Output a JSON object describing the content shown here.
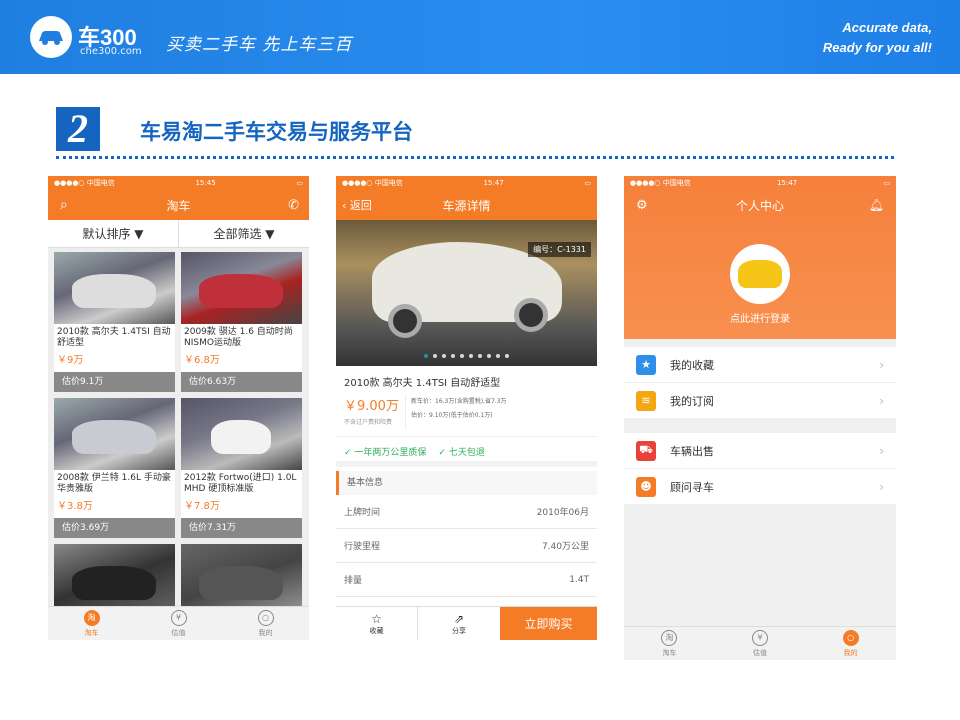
{
  "header": {
    "brand": "车300",
    "domain": "che300.com",
    "slogan": "买卖二手车 先上车三百",
    "tagline_line1": "Accurate data,",
    "tagline_line2": "Ready for you all!"
  },
  "section": {
    "number": "2",
    "title": "车易淘二手车交易与服务平台"
  },
  "status": {
    "carrier": "●●●●○ 中国电信",
    "time1": "15:45",
    "time2": "15:47",
    "time3": "15:47"
  },
  "phone1": {
    "nav_title": "淘车",
    "sort_default": "默认排序",
    "sort_filter": "全部筛选",
    "cars": [
      {
        "name": "2010款 高尔夫 1.4TSI 自动舒适型",
        "price": "￥9万",
        "estimate": "估价9.1万"
      },
      {
        "name": "2009款 骐达 1.6 自动时尚NISMO运动版",
        "price": "￥6.8万",
        "estimate": "估价6.63万"
      },
      {
        "name": "2008款 伊兰特 1.6L 手动豪华贵雅版",
        "price": "￥3.8万",
        "estimate": "估价3.69万"
      },
      {
        "name": "2012款 Fortwo(进口) 1.0L MHD 硬顶标准版",
        "price": "￥7.8万",
        "estimate": "估价7.31万"
      }
    ],
    "tabs": [
      "淘车",
      "估值",
      "我的"
    ]
  },
  "phone2": {
    "back": "返回",
    "nav_title": "车源详情",
    "code": "编号：C-1331",
    "title": "2010款 高尔夫 1.4TSI 自动舒适型",
    "price": "￥9.00万",
    "price_note": "不含过户费和险费",
    "new_price": "新车价：16.3万(含购置税),省7.3万",
    "estimate": "估价：9.10万(低于估价0.1万)",
    "guarantee1": "一年两万公里质保",
    "guarantee2": "七天包退",
    "info_header": "基本信息",
    "info": [
      {
        "label": "上牌时间",
        "value": "2010年06月"
      },
      {
        "label": "行驶里程",
        "value": "7.40万公里"
      },
      {
        "label": "排量",
        "value": "1.4T"
      }
    ],
    "fav": "收藏",
    "share": "分享",
    "buy": "立即购买"
  },
  "phone3": {
    "nav_title": "个人中心",
    "login": "点此进行登录",
    "menu1": [
      {
        "label": "我的收藏",
        "color": "#2f8ee8",
        "icon": "★"
      },
      {
        "label": "我的订阅",
        "color": "#f4a712",
        "icon": "≋"
      }
    ],
    "menu2": [
      {
        "label": "车辆出售",
        "color": "#e8423a",
        "icon": "⛟"
      },
      {
        "label": "顾问寻车",
        "color": "#f47c26",
        "icon": "☻"
      }
    ],
    "tabs": [
      "淘车",
      "估值",
      "我的"
    ]
  }
}
